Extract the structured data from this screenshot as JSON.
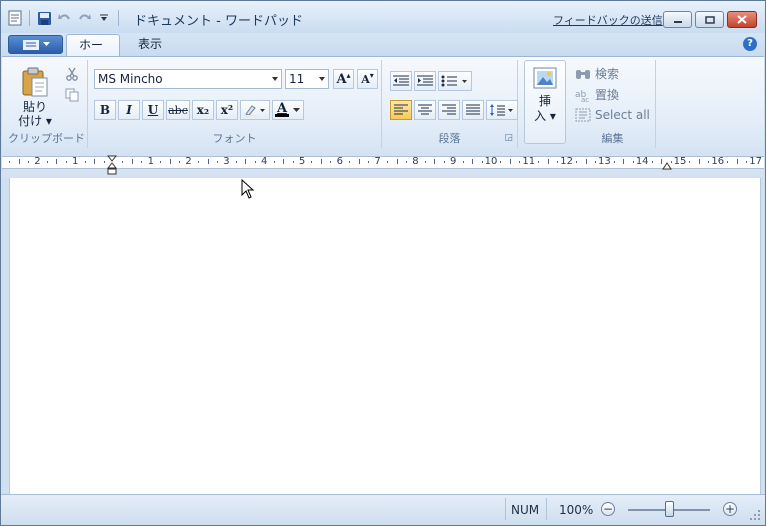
{
  "window": {
    "title": "ドキュメント - ワードパッド",
    "feedback_link": "フィードバックの送信"
  },
  "tabs": [
    {
      "label": "ホーム",
      "active": true
    },
    {
      "label": "表示",
      "active": false
    }
  ],
  "clipboard": {
    "paste_label_line1": "貼り",
    "paste_label_line2": "付け",
    "group_label": "クリップボード"
  },
  "font": {
    "family": "MS Mincho",
    "size": "11",
    "bold": "B",
    "italic": "I",
    "underline": "U",
    "strike": "abc",
    "subscript": "x₂",
    "superscript": "x²",
    "color_letter": "A",
    "grow": "A",
    "shrink": "A",
    "group_label": "フォント"
  },
  "paragraph": {
    "group_label": "段落"
  },
  "insert": {
    "label_line1": "挿",
    "label_line2": "入"
  },
  "editing": {
    "find": "検索",
    "replace": "置換",
    "select_all": "Select all",
    "group_label": "編集"
  },
  "ruler": {
    "ticks": [
      "2",
      "1",
      "1",
      "2",
      "3",
      "4",
      "5",
      "6",
      "7",
      "8",
      "9",
      "10",
      "11",
      "12",
      "13",
      "14",
      "15",
      "16",
      "17"
    ]
  },
  "status": {
    "num": "NUM",
    "zoom": "100%",
    "zoom_level": 0.5
  },
  "colors": {
    "accent": "#2a5ea9",
    "selected_button": "#f8c95a",
    "close_button": "#c4432c"
  }
}
